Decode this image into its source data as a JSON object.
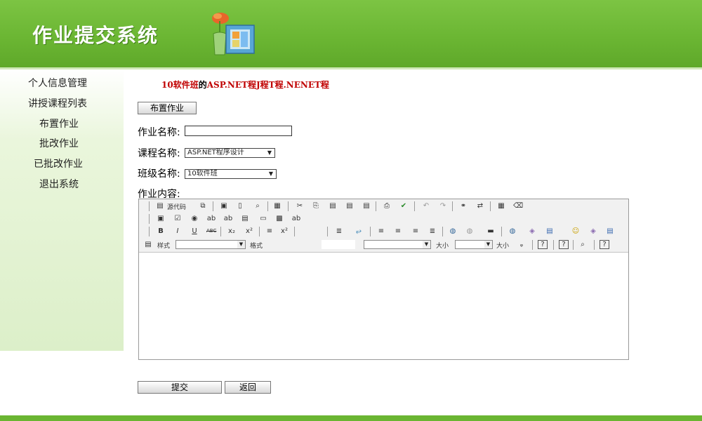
{
  "header": {
    "title": "作业提交系统"
  },
  "sidebar": {
    "items": [
      {
        "label": "个人信息管理"
      },
      {
        "label": "讲授课程列表"
      },
      {
        "label": "布置作业"
      },
      {
        "label": "批改作业"
      },
      {
        "label": "已批改作业"
      },
      {
        "label": "退出系统"
      }
    ]
  },
  "course_info": {
    "class_name": "10软件班",
    "connector": "的",
    "course_name": "ASP.NET程J程T程.NENET程"
  },
  "assign_button": {
    "label": "布置作业"
  },
  "form": {
    "name_label": "作业名称:",
    "name_value": "",
    "course_label": "课程名称:",
    "course_selected": "ASP.NET程序设计",
    "class_label": "班级名称:",
    "class_selected": "10软件班",
    "content_label": "作业内容:"
  },
  "editor": {
    "source_label": "源代码",
    "style_label": "样式",
    "format_label": "格式",
    "size_label_1": "大小",
    "size_label_2": "大小"
  },
  "actions": {
    "submit_label": "提交",
    "back_label": "返回"
  }
}
